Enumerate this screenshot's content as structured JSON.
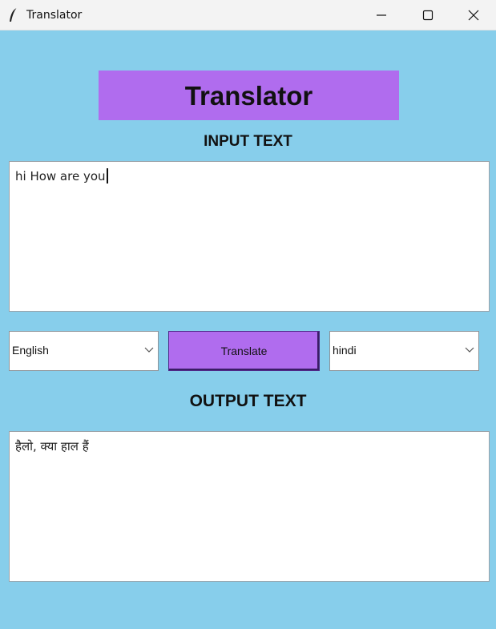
{
  "window": {
    "title": "Translator",
    "icon": "feather-icon",
    "controls": [
      "minimize-icon",
      "maximize-icon",
      "close-icon"
    ]
  },
  "header": {
    "title": "Translator",
    "background": "#b06cee"
  },
  "input": {
    "label": "INPUT TEXT",
    "value": "hi How are you"
  },
  "controls": {
    "source_language": "English",
    "translate_label": "Translate",
    "target_language": "hindi"
  },
  "output": {
    "label": "OUTPUT TEXT",
    "value": "हैलो, क्या हाल हैं"
  },
  "colors": {
    "background": "#87ceeb",
    "accent": "#b06cee"
  }
}
